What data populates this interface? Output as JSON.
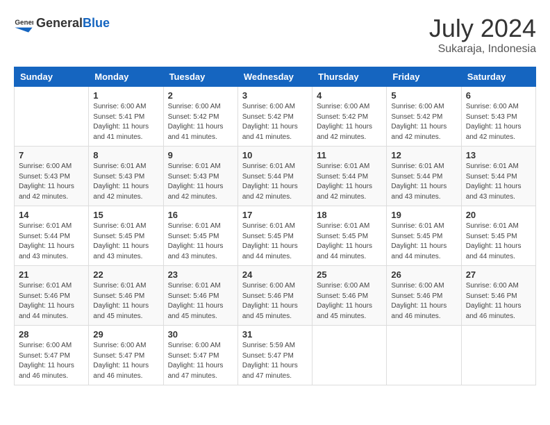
{
  "header": {
    "logo_general": "General",
    "logo_blue": "Blue",
    "month_year": "July 2024",
    "location": "Sukaraja, Indonesia"
  },
  "weekdays": [
    "Sunday",
    "Monday",
    "Tuesday",
    "Wednesday",
    "Thursday",
    "Friday",
    "Saturday"
  ],
  "weeks": [
    [
      {
        "day": "",
        "sunrise": "",
        "sunset": "",
        "daylight": ""
      },
      {
        "day": "1",
        "sunrise": "Sunrise: 6:00 AM",
        "sunset": "Sunset: 5:41 PM",
        "daylight": "Daylight: 11 hours and 41 minutes."
      },
      {
        "day": "2",
        "sunrise": "Sunrise: 6:00 AM",
        "sunset": "Sunset: 5:42 PM",
        "daylight": "Daylight: 11 hours and 41 minutes."
      },
      {
        "day": "3",
        "sunrise": "Sunrise: 6:00 AM",
        "sunset": "Sunset: 5:42 PM",
        "daylight": "Daylight: 11 hours and 41 minutes."
      },
      {
        "day": "4",
        "sunrise": "Sunrise: 6:00 AM",
        "sunset": "Sunset: 5:42 PM",
        "daylight": "Daylight: 11 hours and 42 minutes."
      },
      {
        "day": "5",
        "sunrise": "Sunrise: 6:00 AM",
        "sunset": "Sunset: 5:42 PM",
        "daylight": "Daylight: 11 hours and 42 minutes."
      },
      {
        "day": "6",
        "sunrise": "Sunrise: 6:00 AM",
        "sunset": "Sunset: 5:43 PM",
        "daylight": "Daylight: 11 hours and 42 minutes."
      }
    ],
    [
      {
        "day": "7",
        "sunrise": "Sunrise: 6:00 AM",
        "sunset": "Sunset: 5:43 PM",
        "daylight": "Daylight: 11 hours and 42 minutes."
      },
      {
        "day": "8",
        "sunrise": "Sunrise: 6:01 AM",
        "sunset": "Sunset: 5:43 PM",
        "daylight": "Daylight: 11 hours and 42 minutes."
      },
      {
        "day": "9",
        "sunrise": "Sunrise: 6:01 AM",
        "sunset": "Sunset: 5:43 PM",
        "daylight": "Daylight: 11 hours and 42 minutes."
      },
      {
        "day": "10",
        "sunrise": "Sunrise: 6:01 AM",
        "sunset": "Sunset: 5:44 PM",
        "daylight": "Daylight: 11 hours and 42 minutes."
      },
      {
        "day": "11",
        "sunrise": "Sunrise: 6:01 AM",
        "sunset": "Sunset: 5:44 PM",
        "daylight": "Daylight: 11 hours and 42 minutes."
      },
      {
        "day": "12",
        "sunrise": "Sunrise: 6:01 AM",
        "sunset": "Sunset: 5:44 PM",
        "daylight": "Daylight: 11 hours and 43 minutes."
      },
      {
        "day": "13",
        "sunrise": "Sunrise: 6:01 AM",
        "sunset": "Sunset: 5:44 PM",
        "daylight": "Daylight: 11 hours and 43 minutes."
      }
    ],
    [
      {
        "day": "14",
        "sunrise": "Sunrise: 6:01 AM",
        "sunset": "Sunset: 5:44 PM",
        "daylight": "Daylight: 11 hours and 43 minutes."
      },
      {
        "day": "15",
        "sunrise": "Sunrise: 6:01 AM",
        "sunset": "Sunset: 5:45 PM",
        "daylight": "Daylight: 11 hours and 43 minutes."
      },
      {
        "day": "16",
        "sunrise": "Sunrise: 6:01 AM",
        "sunset": "Sunset: 5:45 PM",
        "daylight": "Daylight: 11 hours and 43 minutes."
      },
      {
        "day": "17",
        "sunrise": "Sunrise: 6:01 AM",
        "sunset": "Sunset: 5:45 PM",
        "daylight": "Daylight: 11 hours and 44 minutes."
      },
      {
        "day": "18",
        "sunrise": "Sunrise: 6:01 AM",
        "sunset": "Sunset: 5:45 PM",
        "daylight": "Daylight: 11 hours and 44 minutes."
      },
      {
        "day": "19",
        "sunrise": "Sunrise: 6:01 AM",
        "sunset": "Sunset: 5:45 PM",
        "daylight": "Daylight: 11 hours and 44 minutes."
      },
      {
        "day": "20",
        "sunrise": "Sunrise: 6:01 AM",
        "sunset": "Sunset: 5:45 PM",
        "daylight": "Daylight: 11 hours and 44 minutes."
      }
    ],
    [
      {
        "day": "21",
        "sunrise": "Sunrise: 6:01 AM",
        "sunset": "Sunset: 5:46 PM",
        "daylight": "Daylight: 11 hours and 44 minutes."
      },
      {
        "day": "22",
        "sunrise": "Sunrise: 6:01 AM",
        "sunset": "Sunset: 5:46 PM",
        "daylight": "Daylight: 11 hours and 45 minutes."
      },
      {
        "day": "23",
        "sunrise": "Sunrise: 6:01 AM",
        "sunset": "Sunset: 5:46 PM",
        "daylight": "Daylight: 11 hours and 45 minutes."
      },
      {
        "day": "24",
        "sunrise": "Sunrise: 6:00 AM",
        "sunset": "Sunset: 5:46 PM",
        "daylight": "Daylight: 11 hours and 45 minutes."
      },
      {
        "day": "25",
        "sunrise": "Sunrise: 6:00 AM",
        "sunset": "Sunset: 5:46 PM",
        "daylight": "Daylight: 11 hours and 45 minutes."
      },
      {
        "day": "26",
        "sunrise": "Sunrise: 6:00 AM",
        "sunset": "Sunset: 5:46 PM",
        "daylight": "Daylight: 11 hours and 46 minutes."
      },
      {
        "day": "27",
        "sunrise": "Sunrise: 6:00 AM",
        "sunset": "Sunset: 5:46 PM",
        "daylight": "Daylight: 11 hours and 46 minutes."
      }
    ],
    [
      {
        "day": "28",
        "sunrise": "Sunrise: 6:00 AM",
        "sunset": "Sunset: 5:47 PM",
        "daylight": "Daylight: 11 hours and 46 minutes."
      },
      {
        "day": "29",
        "sunrise": "Sunrise: 6:00 AM",
        "sunset": "Sunset: 5:47 PM",
        "daylight": "Daylight: 11 hours and 46 minutes."
      },
      {
        "day": "30",
        "sunrise": "Sunrise: 6:00 AM",
        "sunset": "Sunset: 5:47 PM",
        "daylight": "Daylight: 11 hours and 47 minutes."
      },
      {
        "day": "31",
        "sunrise": "Sunrise: 5:59 AM",
        "sunset": "Sunset: 5:47 PM",
        "daylight": "Daylight: 11 hours and 47 minutes."
      },
      {
        "day": "",
        "sunrise": "",
        "sunset": "",
        "daylight": ""
      },
      {
        "day": "",
        "sunrise": "",
        "sunset": "",
        "daylight": ""
      },
      {
        "day": "",
        "sunrise": "",
        "sunset": "",
        "daylight": ""
      }
    ]
  ]
}
